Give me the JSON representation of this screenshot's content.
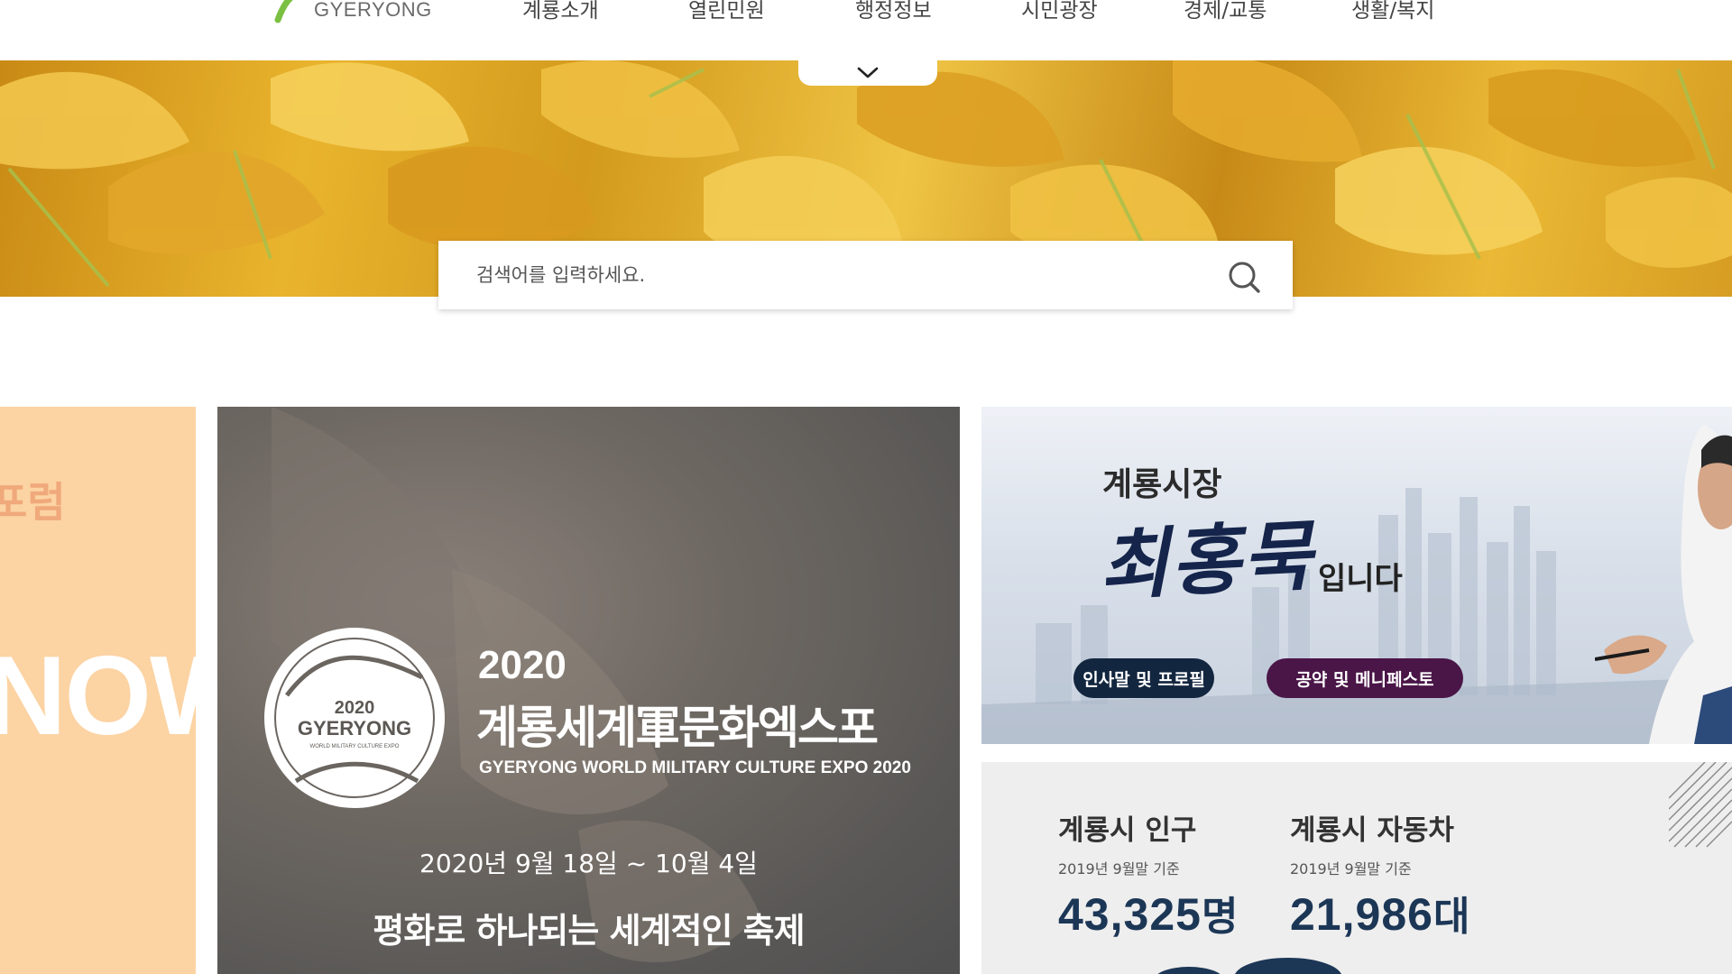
{
  "header": {
    "logo_text": "GYERYONG",
    "nav": [
      "계룡소개",
      "열린민원",
      "행정정보",
      "시민광장",
      "경제/교통",
      "생활/복지"
    ],
    "menu_toggle_icon": "chevron-down-icon"
  },
  "search": {
    "placeholder": "검색어를 입력하세요.",
    "icon": "search-icon"
  },
  "left_card": {
    "partial_title": "포럼",
    "partial_word": "NOW"
  },
  "expo": {
    "emblem_year": "2020",
    "emblem_name": "GYERYONG",
    "emblem_caption": "WORLD MILITARY CULTURE EXPO",
    "year": "2020",
    "title": "계룡세계軍문화엑스포",
    "subtitle": "GYERYONG WORLD MILITARY CULTURE EXPO 2020",
    "date": "2020년 9월 18일 ~ 10월 4일",
    "slogan": "평화로 하나되는 세계적인 축제"
  },
  "mayor": {
    "label": "계룡시장",
    "name": "최홍묵",
    "suffix": "입니다",
    "btn_profile": "인사말 및 프로필",
    "btn_pledge": "공약 및 메니페스토"
  },
  "stats": [
    {
      "title": "계룡시 인구",
      "note": "2019년 9월말 기준",
      "value": "43,325",
      "unit": "명"
    },
    {
      "title": "계룡시 자동차",
      "note": "2019년 9월말 기준",
      "value": "21,986",
      "unit": "대"
    }
  ],
  "colors": {
    "navy": "#13263f",
    "plum": "#4a1547",
    "stat_value": "#1c3656",
    "peach": "#fcd3a3"
  }
}
